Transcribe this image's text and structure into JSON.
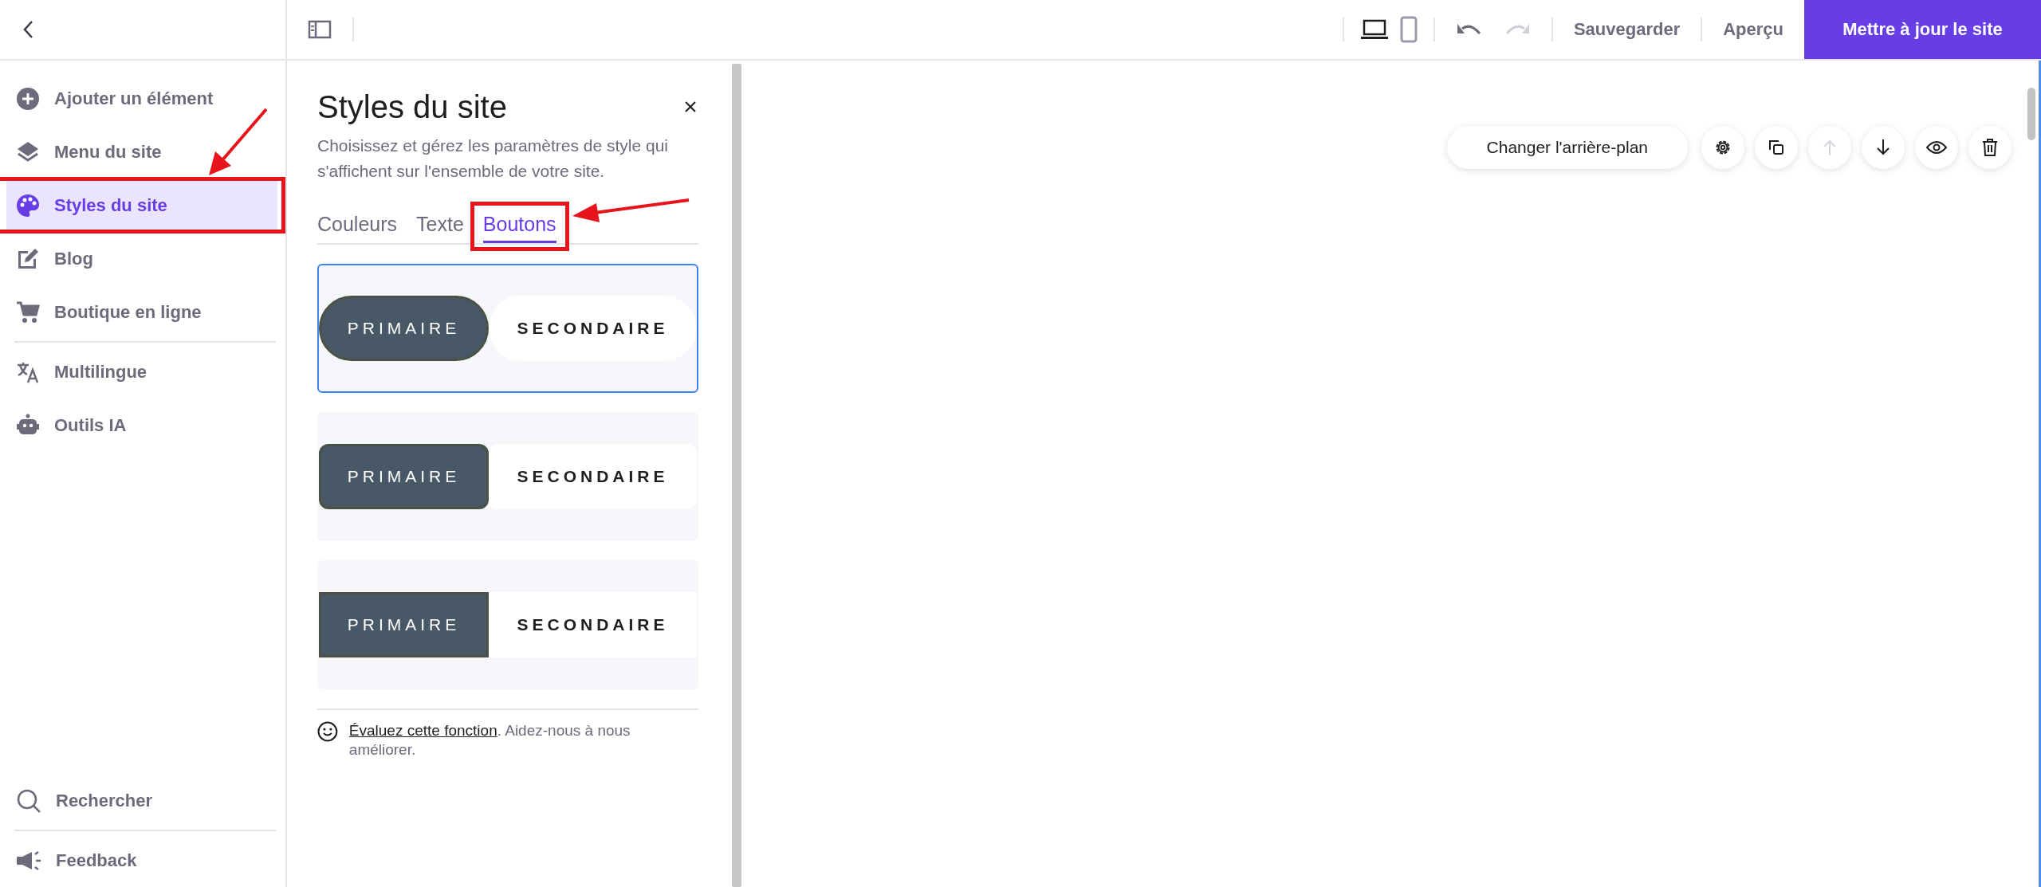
{
  "topbar": {
    "devices": [
      {
        "kind": "desktop",
        "selected": true
      },
      {
        "kind": "mobile",
        "selected": false
      }
    ],
    "undo": {
      "disabled": false
    },
    "redo": {
      "disabled": true
    },
    "save": "Sauvegarder",
    "preview": "Aperçu",
    "publish": "Mettre à jour le site"
  },
  "sidebar": {
    "items": [
      {
        "kind": "plus",
        "label": "Ajouter un élément",
        "selected": false,
        "annotated": false
      },
      {
        "kind": "layers",
        "label": "Menu du site",
        "selected": false,
        "annotated": false
      },
      {
        "kind": "palette",
        "label": "Styles du site",
        "selected": true,
        "annotated": true
      },
      {
        "kind": "edit",
        "label": "Blog",
        "selected": false,
        "annotated": false
      },
      {
        "kind": "cart",
        "label": "Boutique en ligne",
        "selected": false,
        "annotated": false
      },
      {
        "kind": "translate",
        "label": "Multilingue",
        "selected": false,
        "annotated": false
      },
      {
        "kind": "robot",
        "label": "Outils IA",
        "selected": false,
        "annotated": false
      }
    ],
    "bottom": [
      {
        "kind": "search",
        "label": "Rechercher"
      },
      {
        "kind": "megaphone",
        "label": "Feedback"
      }
    ]
  },
  "panel": {
    "title": "Styles du site",
    "description": "Choisissez et gérez les paramètres de style qui s'affichent sur l'ensemble de votre site.",
    "tabs": [
      {
        "label": "Couleurs",
        "selected": false,
        "annotated": false
      },
      {
        "label": "Texte",
        "selected": false,
        "annotated": false
      },
      {
        "label": "Boutons",
        "selected": true,
        "annotated": true
      }
    ],
    "styles": [
      {
        "kind": "pill",
        "selected": true,
        "primary": "PRIMAIRE",
        "secondary": "SECONDAIRE"
      },
      {
        "kind": "rounded",
        "selected": false,
        "primary": "PRIMAIRE",
        "secondary": "SECONDAIRE"
      },
      {
        "kind": "square",
        "selected": false,
        "primary": "PRIMAIRE",
        "secondary": "SECONDAIRE"
      }
    ],
    "feedback": {
      "link": "Évaluez cette fonction",
      "text": ". Aidez-nous à nous améliorer."
    }
  },
  "canvas": {
    "toolbar": {
      "background_button": "Changer l'arrière-plan",
      "actions": [
        {
          "kind": "settings",
          "disabled": false
        },
        {
          "kind": "duplicate",
          "disabled": false
        },
        {
          "kind": "up",
          "disabled": true
        },
        {
          "kind": "down",
          "disabled": false
        },
        {
          "kind": "visibility",
          "disabled": false
        },
        {
          "kind": "delete",
          "disabled": false
        }
      ]
    }
  }
}
